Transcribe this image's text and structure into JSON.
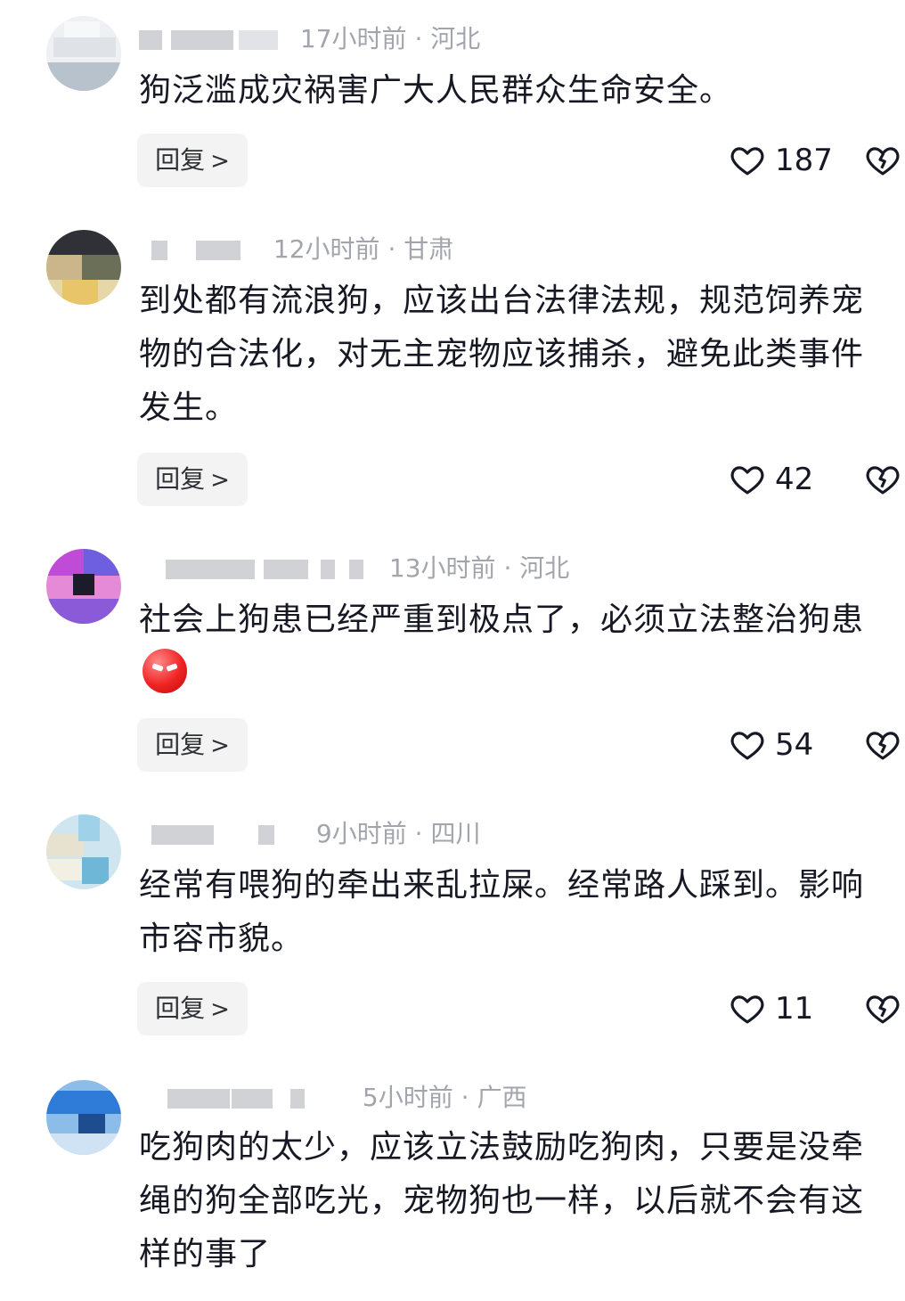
{
  "comments": [
    {
      "time": "17小时前",
      "location": "河北",
      "text": "狗泛滥成灾祸害广大人民群众生命安全。",
      "reply_label": "回复",
      "likes": "187",
      "avatar_colors": [
        "#f4f5f7",
        "#dfe3e8",
        "#b8c2cc",
        "#8c98a6"
      ]
    },
    {
      "time": "12小时前",
      "location": "甘肃",
      "text": "到处都有流浪狗，应该出台法律法规，规范饲养宠物的合法化，对无主宠物应该捕杀，避免此类事件发生。",
      "reply_label": "回复",
      "likes": "42",
      "avatar_colors": [
        "#2f3136",
        "#cbb58a",
        "#e6d7a8",
        "#6b6f57"
      ]
    },
    {
      "time": "13小时前",
      "location": "河北",
      "text": "社会上狗患已经严重到极点了，必须立法整治狗患",
      "reply_label": "回复",
      "likes": "54",
      "avatar_colors": [
        "#c04bd7",
        "#6d5fe0",
        "#e48ad6",
        "#1b1b2a"
      ]
    },
    {
      "time": "9小时前",
      "location": "四川",
      "text": "经常有喂狗的牵出来乱拉屎。经常路人踩到。影响市容市貌。",
      "reply_label": "回复",
      "likes": "11",
      "avatar_colors": [
        "#e7e2cf",
        "#9fd2e8",
        "#cfe6f1",
        "#6fb7d6"
      ]
    },
    {
      "time": "5小时前",
      "location": "广西",
      "text": "吃狗肉的太少，应该立法鼓励吃狗肉，只要是没牵绳的狗全部吃光，宠物狗也一样，以后就不会有这样的事了",
      "reply_label": "回复",
      "likes": "",
      "avatar_colors": [
        "#2f7bd8",
        "#8cbde9",
        "#1d4c8f",
        "#cfe3f5"
      ]
    }
  ],
  "icons": {
    "like": "heart-outline-icon",
    "dislike": "broken-heart-icon",
    "reply_chevron": "chevron-right-icon"
  },
  "meta_separator": "·",
  "colors": {
    "text": "#161823",
    "meta": "#a3a5ad",
    "reply_bg": "#f3f3f4"
  }
}
